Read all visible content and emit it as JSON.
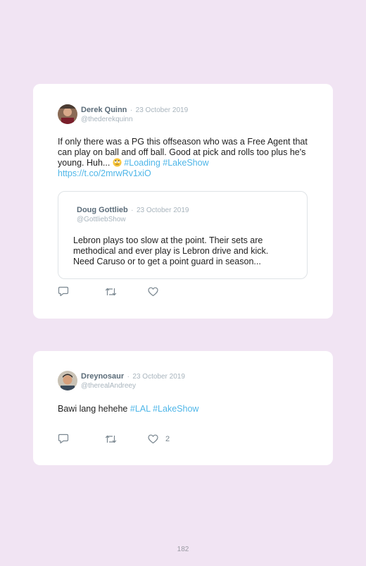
{
  "tweets": [
    {
      "author": "Derek Quinn",
      "separator": "·",
      "date": "23 October 2019",
      "handle": "@thederekquinn",
      "text_main": "If only there was a PG this offseason who was a Free Agent that can play on ball and off ball. Good at pick and rolls too plus he's young. Huh...",
      "emoji": "rolling-eyes-emoji",
      "tags": [
        "#Loading",
        "#LakeShow"
      ],
      "link": "https://t.co/2mrwRv1xiO",
      "quoted": {
        "author": "Doug Gottlieb",
        "separator": "·",
        "date": "23 October 2019",
        "handle": "@GottliebShow",
        "text": "Lebron plays too slow at the point. Their sets are methodical and ever play is Lebron drive and kick. Need Caruso or to get a point guard in season..."
      },
      "likes": ""
    },
    {
      "author": "Dreynosaur",
      "separator": "·",
      "date": "23 October 2019",
      "handle": "@therealAndreey",
      "text_main": "Bawi lang hehehe",
      "tags": [
        "#LAL",
        "#LakeShow"
      ],
      "likes": "2"
    }
  ],
  "page_number": "182",
  "colors": {
    "background": "#f1e4f3",
    "card": "#ffffff",
    "hashtag": "#4fb6e8",
    "name": "#5a6b78",
    "muted": "#a8b4bd"
  }
}
